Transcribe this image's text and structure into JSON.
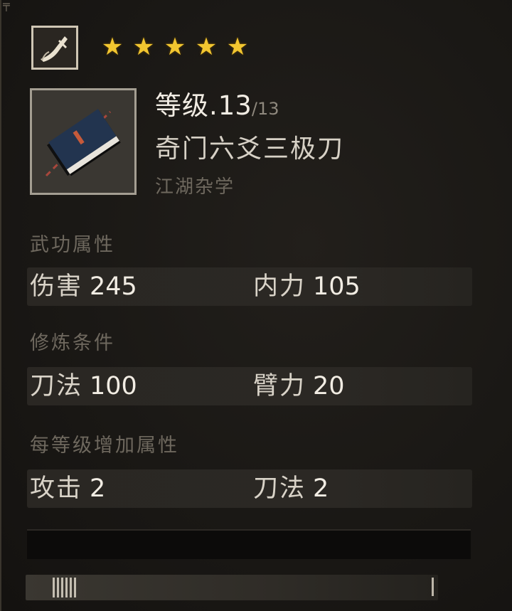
{
  "skill": {
    "type_icon": "saber-icon",
    "book_icon": "martial-book-icon",
    "stars": [
      "★",
      "★",
      "★",
      "★",
      "★"
    ],
    "level_label": "等级.",
    "level_current": "13",
    "level_max": "/13",
    "name": "奇门六爻三极刀",
    "category": "江湖杂学"
  },
  "sections": {
    "attributes": {
      "title": "武功属性",
      "left": {
        "label": "伤害",
        "value": "245"
      },
      "right": {
        "label": "内力",
        "value": "105"
      }
    },
    "requirements": {
      "title": "修炼条件",
      "left": {
        "label": "刀法",
        "value": "100"
      },
      "right": {
        "label": "臂力",
        "value": "20"
      }
    },
    "per_level": {
      "title": "每等级增加属性",
      "left": {
        "label": "攻击",
        "value": "2"
      },
      "right": {
        "label": "刀法",
        "value": "2"
      }
    }
  },
  "colors": {
    "star": "#f2c630",
    "panel_bg": "#1a1815",
    "text_primary": "#f1ece3",
    "text_muted": "#6e685e"
  }
}
